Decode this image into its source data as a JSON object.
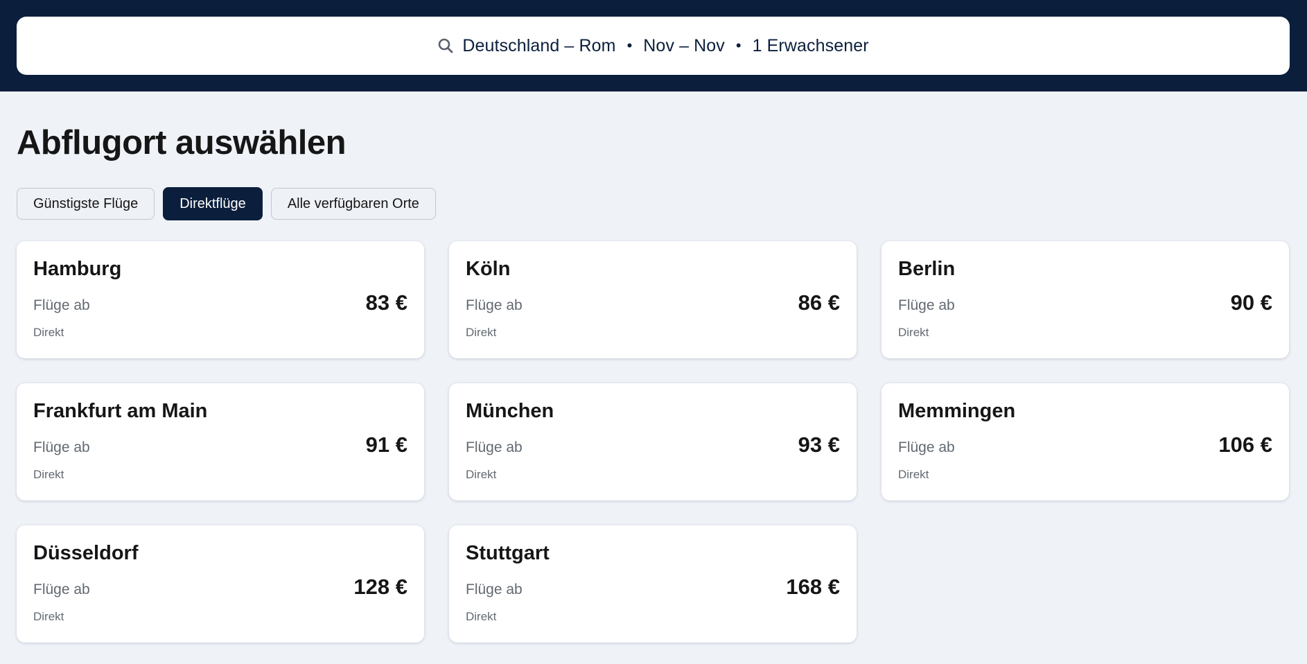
{
  "search": {
    "route": "Deutschland – Rom",
    "dates": "Nov – Nov",
    "passengers": "1 Erwachsener",
    "icon": "search-icon"
  },
  "page": {
    "title": "Abflugort auswählen"
  },
  "filters": [
    {
      "label": "Günstigste Flüge",
      "active": false
    },
    {
      "label": "Direktflüge",
      "active": true
    },
    {
      "label": "Alle verfügbaren Orte",
      "active": false
    }
  ],
  "colors": {
    "header_bg": "#0b1f3c",
    "page_bg": "#eff2f7",
    "active_chip": "#0b1f3c"
  },
  "results": [
    {
      "city": "Hamburg",
      "from_label": "Flüge ab",
      "price": "83 €",
      "stops": "Direkt"
    },
    {
      "city": "Köln",
      "from_label": "Flüge ab",
      "price": "86 €",
      "stops": "Direkt"
    },
    {
      "city": "Berlin",
      "from_label": "Flüge ab",
      "price": "90 €",
      "stops": "Direkt"
    },
    {
      "city": "Frankfurt am Main",
      "from_label": "Flüge ab",
      "price": "91 €",
      "stops": "Direkt"
    },
    {
      "city": "München",
      "from_label": "Flüge ab",
      "price": "93 €",
      "stops": "Direkt"
    },
    {
      "city": "Memmingen",
      "from_label": "Flüge ab",
      "price": "106 €",
      "stops": "Direkt"
    },
    {
      "city": "Düsseldorf",
      "from_label": "Flüge ab",
      "price": "128 €",
      "stops": "Direkt"
    },
    {
      "city": "Stuttgart",
      "from_label": "Flüge ab",
      "price": "168 €",
      "stops": "Direkt"
    }
  ]
}
